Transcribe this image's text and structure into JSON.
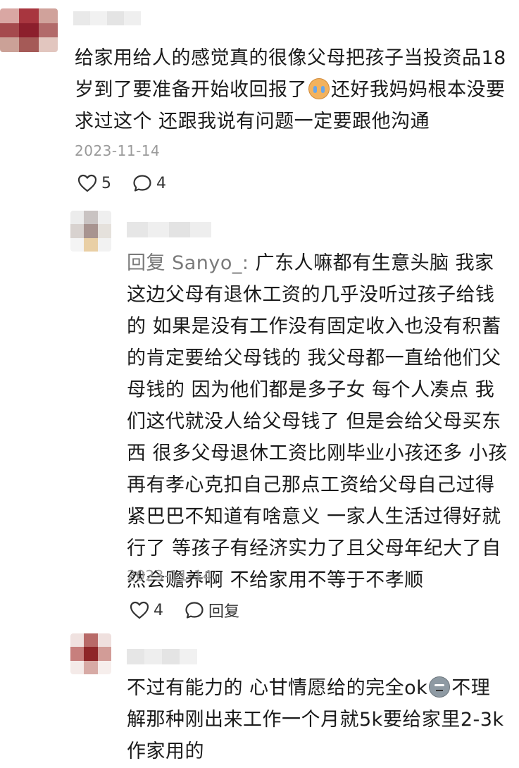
{
  "colors": {
    "text": "#1b1b1b",
    "meta": "#9a9a9a",
    "mention": "#7a7a7a"
  },
  "comments": [
    {
      "text_before": "给家用给人的感觉真的很像父母把孩子当投资品18岁到了要准备开始收回报了",
      "emoji": "crying-face-emoji",
      "text_after": "还好我妈妈根本没要求过这个 还跟我说有问题一定要跟他沟通",
      "date": "2023-11-14",
      "likes": "5",
      "replies": "4"
    },
    {
      "mention": "回复 Sanyo_:",
      "text": " 广东人嘛都有生意头脑 我家这边父母有退休工资的几乎没听过孩子给钱的 如果是没有工作没有固定收入也没有积蓄的肯定要给父母钱的 我父母都一直给他们父母钱的 因为他们都是多子女 每个人凑点 我们这代就没人给父母钱了 但是会给父母买东西 很多父母退休工资比刚毕业小孩还多 小孩再有孝心克扣自己那点工资给父母自己过得紧巴巴不知道有啥意义 一家人生活过得好就行了 等孩子有经济实力了且父母年纪大了自然会赡养啊 不给家用不等于不孝顺",
      "date": "2023-11-14",
      "likes": "4",
      "reply_label": "回复"
    },
    {
      "text_before": "不过有能力的 心甘情愿给的完全ok",
      "emoji": "smirk-face-emoji",
      "text_after": "不理解那种刚出来工作一个月就5k要给家里2-3k作家用的"
    }
  ]
}
